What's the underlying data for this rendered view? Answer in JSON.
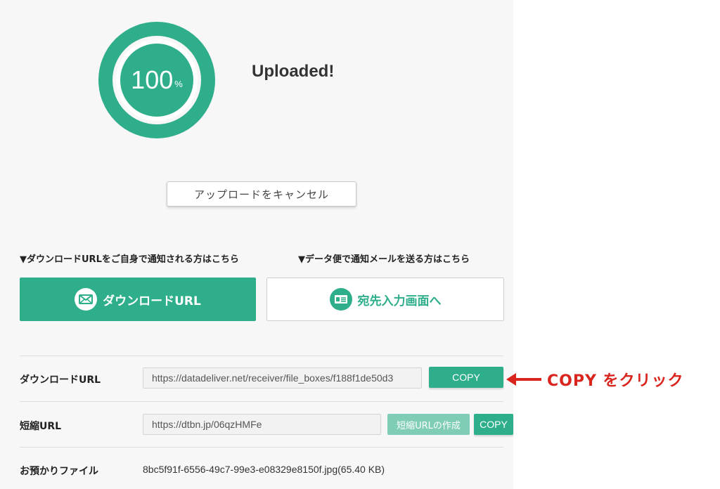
{
  "progress": {
    "value": 1.0,
    "number": "100",
    "unit": "%"
  },
  "status_text": "Uploaded!",
  "cancel_button": "アップロードをキャンセル",
  "hints": {
    "left": "▼ダウンロードURLをご自身で通知される方はこちら",
    "right": "▼データ便で通知メールを送る方はこちら"
  },
  "buttons": {
    "download_url": {
      "label": "ダウンロードURL",
      "icon": "mail-icon"
    },
    "recipient": {
      "label": "宛先入力画面へ",
      "icon": "id-card-icon"
    }
  },
  "rows": {
    "download": {
      "label": "ダウンロードURL",
      "value": "https://datadeliver.net/receiver/file_boxes/f188f1de50d3",
      "copy": "COPY"
    },
    "short": {
      "label": "短縮URL",
      "value": "https://dtbn.jp/06qzHMFe",
      "make": "短縮URLの作成",
      "copy": "COPY"
    },
    "file": {
      "label": "お預かりファイル",
      "value": "8bc5f91f-6556-49c7-99e3-e08329e8150f.jpg(65.40 KB)"
    }
  },
  "annotation": "COPY をクリック",
  "colors": {
    "accent": "#2eae8b",
    "accent_light": "#7fcdb6",
    "annotation": "#d9251d"
  }
}
